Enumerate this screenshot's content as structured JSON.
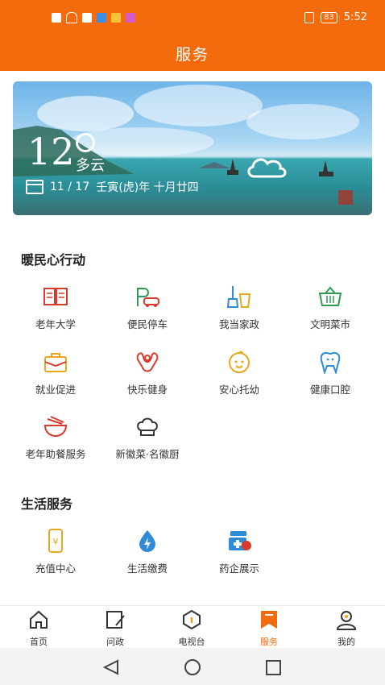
{
  "status_bar": {
    "time": "5:52",
    "battery": "83"
  },
  "header": {
    "title": "服务"
  },
  "weather": {
    "temperature": "12",
    "condition": "多云",
    "date": "11 / 17",
    "lunar": "壬寅(虎)年 十月廿四"
  },
  "section1": {
    "title": "暖民心行动",
    "items": [
      {
        "label": "老年大学",
        "icon": "book-icon"
      },
      {
        "label": "便民停车",
        "icon": "parking-car-icon"
      },
      {
        "label": "我当家政",
        "icon": "broom-bucket-icon"
      },
      {
        "label": "文明菜市",
        "icon": "basket-icon"
      },
      {
        "label": "就业促进",
        "icon": "briefcase-icon"
      },
      {
        "label": "快乐健身",
        "icon": "muscle-icon"
      },
      {
        "label": "安心托幼",
        "icon": "baby-face-icon"
      },
      {
        "label": "健康口腔",
        "icon": "tooth-icon"
      },
      {
        "label": "老年助餐服务",
        "icon": "meal-bowl-icon"
      },
      {
        "label": "新徽菜·名徽厨",
        "icon": "chef-hat-icon"
      }
    ]
  },
  "section2": {
    "title": "生活服务",
    "items": [
      {
        "label": "充值中心",
        "icon": "phone-recharge-icon"
      },
      {
        "label": "生活缴费",
        "icon": "utility-payment-icon"
      },
      {
        "label": "药企展示",
        "icon": "medicine-box-icon"
      }
    ]
  },
  "tabbar": {
    "items": [
      {
        "label": "首页",
        "icon": "home-icon"
      },
      {
        "label": "问政",
        "icon": "edit-icon"
      },
      {
        "label": "电视台",
        "icon": "tv-icon"
      },
      {
        "label": "服务",
        "icon": "bookmark-icon"
      },
      {
        "label": "我的",
        "icon": "user-icon"
      }
    ],
    "active": "服务"
  },
  "colors": {
    "brand": "#f46b0e",
    "icon_red": "#d93a2b",
    "icon_green": "#2d9b52",
    "icon_blue": "#2f8bd8",
    "icon_yellow": "#e8a81c"
  }
}
